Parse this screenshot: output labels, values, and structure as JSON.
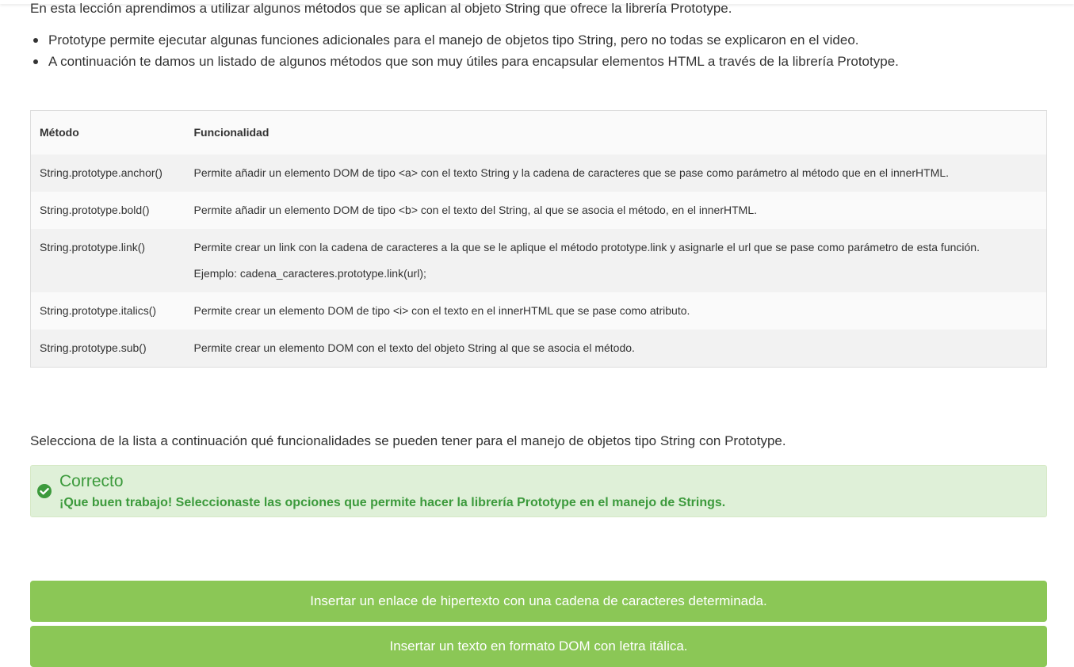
{
  "intro": "En esta lección aprendimos a utilizar algunos métodos que se aplican al objeto String que ofrece la librería Prototype.",
  "bullets": [
    "Prototype permite ejecutar algunas funciones adicionales para el manejo de objetos tipo String, pero no todas se explicaron en el video.",
    "A continuación te damos un listado de algunos métodos que son muy útiles para encapsular elementos HTML a través de la librería Prototype."
  ],
  "table": {
    "headers": [
      "Método",
      "Funcionalidad"
    ],
    "rows": [
      {
        "method": "String.prototype.anchor()",
        "description": "Permite añadir un elemento DOM de tipo <a> con el texto String y la cadena de caracteres que se pase como parámetro al método que en el innerHTML."
      },
      {
        "method": "String.prototype.bold()",
        "description": "Permite añadir un elemento DOM de tipo <b> con el texto del String, al que se asocia el método, en el innerHTML."
      },
      {
        "method": "String.prototype.link()",
        "description": "Permite crear un link con la cadena de caracteres a la que se le aplique el método prototype.link y asignarle el url que se pase como parámetro de esta función.",
        "example": "Ejemplo: cadena_caracteres.prototype.link(url);"
      },
      {
        "method": "String.prototype.italics()",
        "description": "Permite crear un elemento DOM de tipo <i> con el texto en el innerHTML que se pase como atributo."
      },
      {
        "method": "String.prototype.sub()",
        "description": "Permite crear un elemento DOM con el texto del objeto String al que se asocia el método."
      }
    ]
  },
  "question": "Selecciona de la lista a continuación qué funcionalidades se pueden tener para el manejo de objetos tipo String con Prototype.",
  "feedback": {
    "icon": "check-circle-icon",
    "title": "Correcto",
    "message": "¡Que buen trabajo! Seleccionaste las opciones que permite hacer la librería Prototype en el manejo de Strings.",
    "color": "#3c9a3c",
    "background": "#dff0d8"
  },
  "options": [
    "Insertar un enlace de hipertexto con una cadena de caracteres determinada.",
    "Insertar un texto en formato DOM con letra itálica."
  ],
  "colors": {
    "option_selected": "#8bc756"
  }
}
